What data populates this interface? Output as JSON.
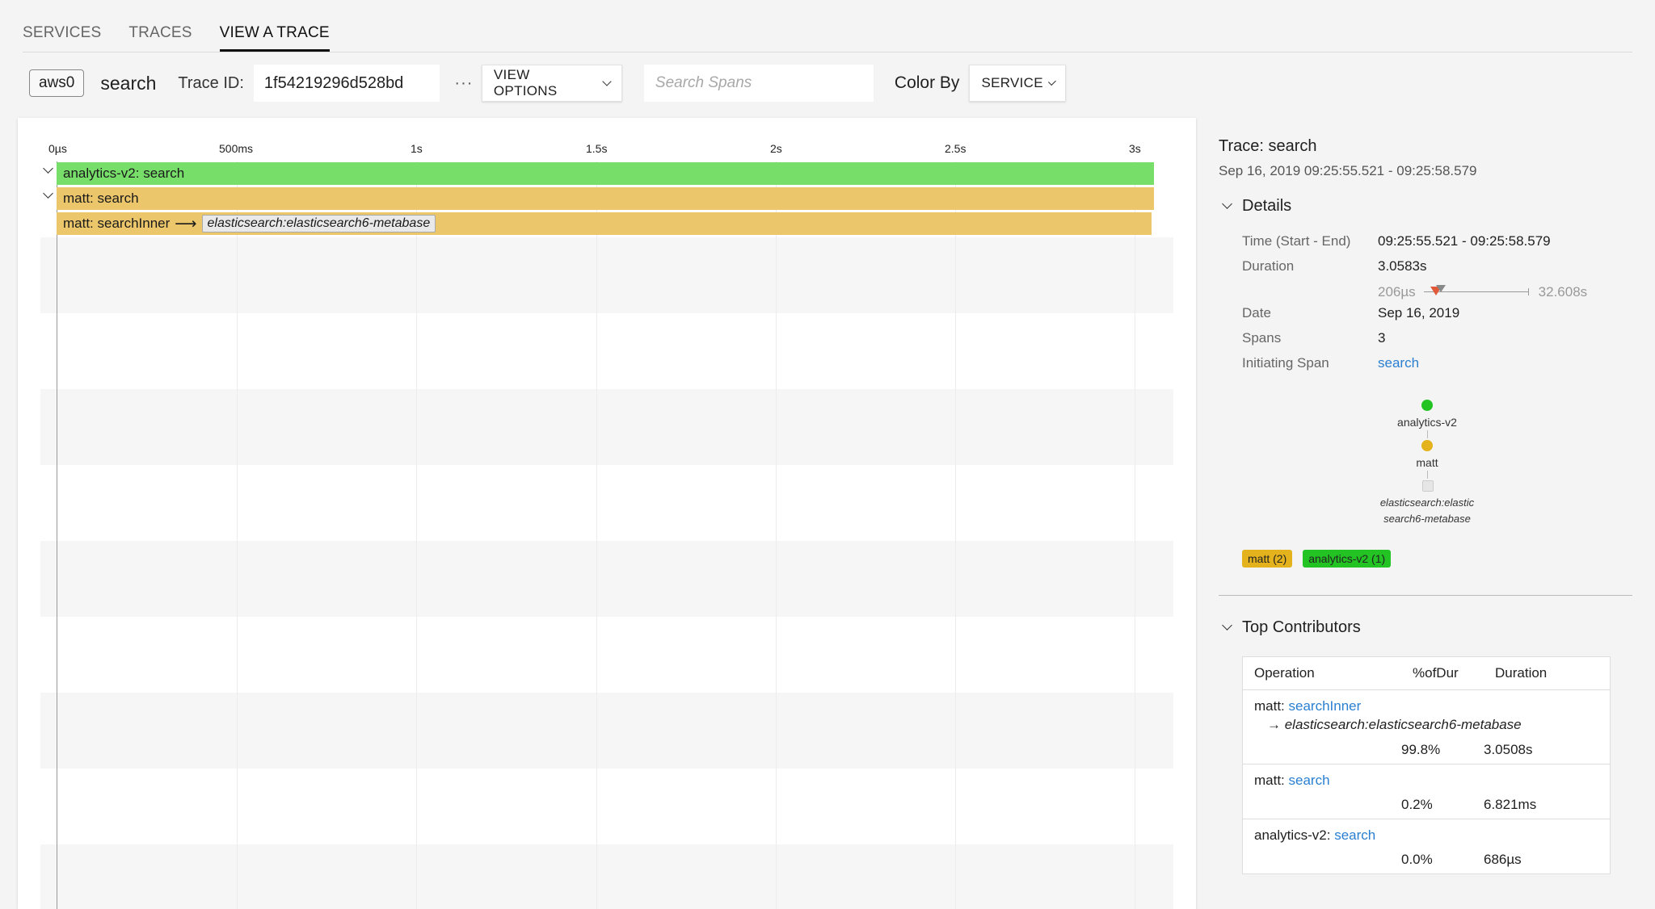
{
  "nav": {
    "tabs": [
      {
        "label": "SERVICES",
        "active": false
      },
      {
        "label": "TRACES",
        "active": false
      },
      {
        "label": "VIEW A TRACE",
        "active": true
      }
    ]
  },
  "toolbar": {
    "environment": "aws0",
    "trace_name": "search",
    "trace_id_label": "Trace ID:",
    "trace_id": "1f54219296d528bd",
    "more_label": "···",
    "view_options_label": "VIEW OPTIONS",
    "search_placeholder": "Search Spans",
    "color_by_label": "Color By",
    "color_by_value": "SERVICE"
  },
  "timeline": {
    "ticks": [
      "0µs",
      "500ms",
      "1s",
      "1.5s",
      "2s",
      "2.5s",
      "3s"
    ],
    "spans": [
      {
        "service": "analytics-v2",
        "operation": "search",
        "label": "analytics-v2: search",
        "color": "#77de6a",
        "start": 0.0,
        "end": 1.0,
        "collapsible": true
      },
      {
        "service": "matt",
        "operation": "search",
        "label": "matt: search",
        "color": "#ebc66b",
        "start": 0.0,
        "end": 1.0,
        "collapsible": true
      },
      {
        "service": "matt",
        "operation": "searchInner",
        "label": "matt: searchInner",
        "peer": "elasticsearch:elasticsearch6-metabase",
        "color": "#ebc66b",
        "start": 0.0,
        "end": 0.998,
        "collapsible": false
      }
    ]
  },
  "side": {
    "title": "Trace: search",
    "time_range": "Sep 16, 2019 09:25:55.521 - 09:25:58.579",
    "details_heading": "Details",
    "details": {
      "time_label": "Time (Start - End)",
      "time_value": "09:25:55.521 - 09:25:58.579",
      "duration_label": "Duration",
      "duration_value": "3.0583s",
      "range_min": "206µs",
      "range_max": "32.608s",
      "date_label": "Date",
      "date_value": "Sep 16, 2019",
      "spans_label": "Spans",
      "spans_value": "3",
      "initiating_label": "Initiating Span",
      "initiating_value": "search"
    },
    "graph": {
      "nodes": [
        {
          "label": "analytics-v2",
          "color": "#22c322"
        },
        {
          "label": "matt",
          "color": "#e4b21c"
        },
        {
          "label": "elasticsearch:elastic search6-metabase",
          "color": "#e6e6e6"
        }
      ]
    },
    "legend": [
      {
        "label": "matt (2)",
        "color": "#e4b21c"
      },
      {
        "label": "analytics-v2 (1)",
        "color": "#22c322"
      }
    ],
    "contributors_heading": "Top Contributors",
    "contributors_columns": [
      "Operation",
      "%ofDur",
      "Duration"
    ],
    "contributors": [
      {
        "service": "matt: ",
        "operation": "searchInner",
        "peer": "→ elasticsearch:elasticsearch6-metabase",
        "pct": "99.8%",
        "duration": "3.0508s"
      },
      {
        "service": "matt: ",
        "operation": "search",
        "peer": "",
        "pct": "0.2%",
        "duration": "6.821ms"
      },
      {
        "service": "analytics-v2: ",
        "operation": "search",
        "peer": "",
        "pct": "0.0%",
        "duration": "686µs"
      }
    ]
  }
}
